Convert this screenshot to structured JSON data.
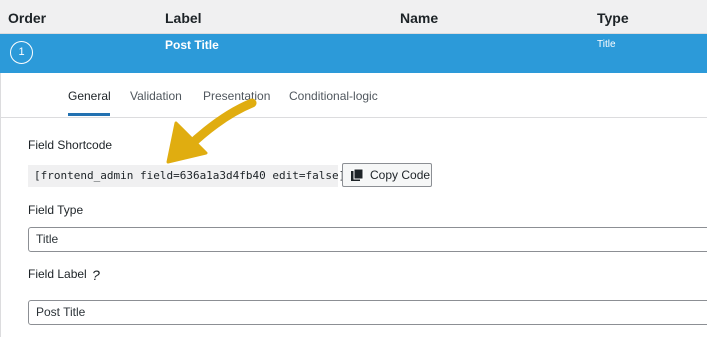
{
  "columns": {
    "order": "Order",
    "label": "Label",
    "name": "Name",
    "type": "Type"
  },
  "field_row": {
    "order": "1",
    "label": "Post Title",
    "type": "Title"
  },
  "tabs": [
    {
      "label": "General",
      "active": true
    },
    {
      "label": "Validation",
      "active": false
    },
    {
      "label": "Presentation",
      "active": false
    },
    {
      "label": "Conditional-logic",
      "active": false
    }
  ],
  "shortcode": {
    "label": "Field Shortcode",
    "value": "[frontend_admin field=636a1a3d4fb40 edit=false]",
    "copy_button_label": "Copy Code",
    "copy_icon": "copy-icon"
  },
  "field_type": {
    "label": "Field Type",
    "value": "Title"
  },
  "field_label": {
    "label": "Field Label",
    "help": "?",
    "value": "Post Title"
  },
  "colors": {
    "row_highlight": "#2c9ad9",
    "annotation_arrow": "#e0ad10",
    "active_tab_underline": "#2271b1"
  }
}
